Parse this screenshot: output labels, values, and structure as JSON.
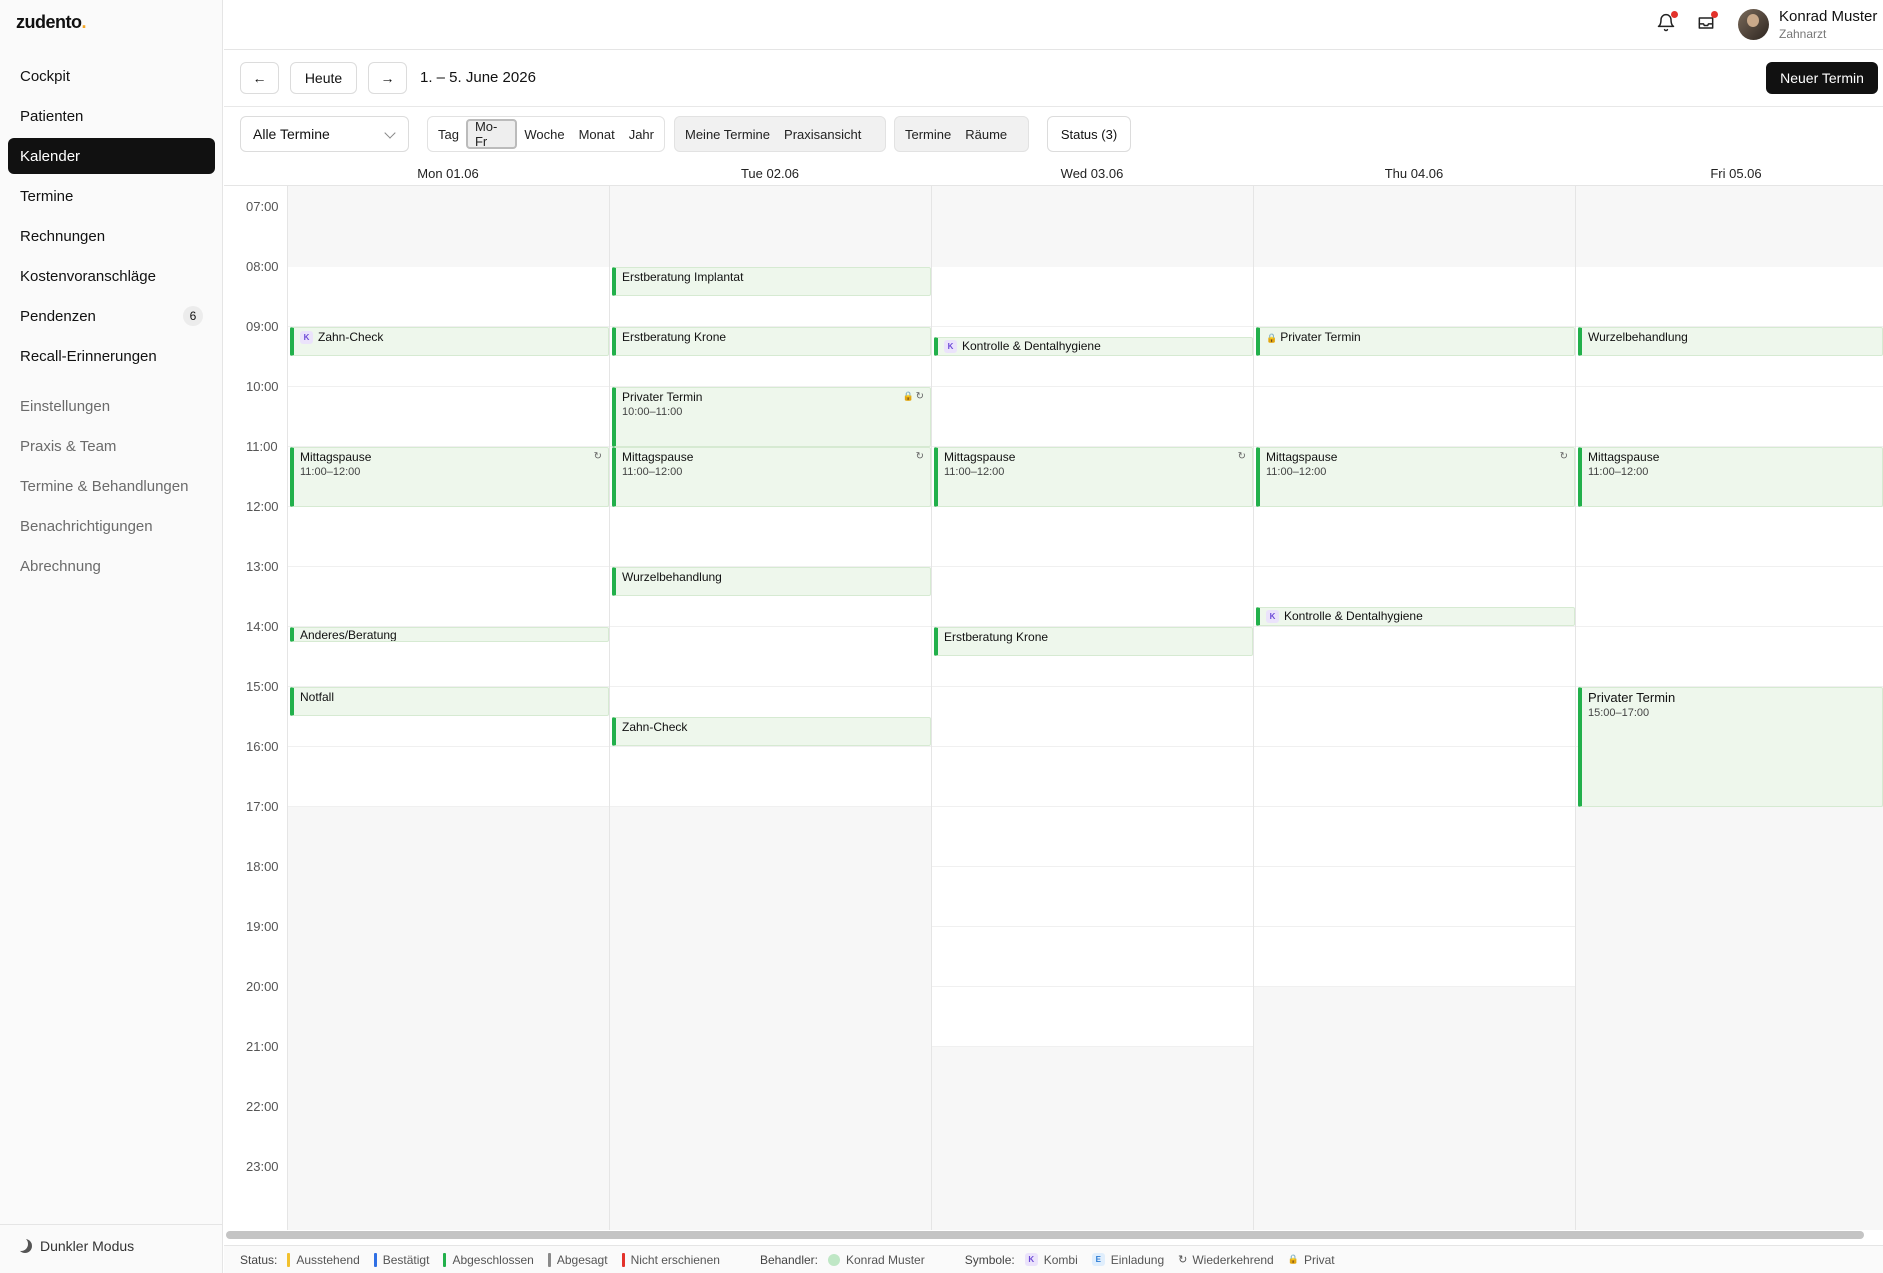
{
  "app": {
    "logo": "zudento",
    "logo_dot": "."
  },
  "sidebar": {
    "items": [
      {
        "label": "Cockpit"
      },
      {
        "label": "Patienten"
      },
      {
        "label": "Kalender",
        "active": true
      },
      {
        "label": "Termine"
      },
      {
        "label": "Rechnungen"
      },
      {
        "label": "Kostenvoranschläge"
      },
      {
        "label": "Pendenzen",
        "badge": "6"
      },
      {
        "label": "Recall-Erinnerungen"
      }
    ],
    "settings_heading": "Einstellungen",
    "settings_items": [
      {
        "label": "Praxis & Team"
      },
      {
        "label": "Termine & Behandlungen"
      },
      {
        "label": "Benachrichtigungen"
      },
      {
        "label": "Abrechnung"
      }
    ],
    "dark_mode": "Dunkler Modus"
  },
  "header": {
    "user_name": "Konrad Muster",
    "user_role": "Zahnarzt",
    "notifications": {
      "bell_unread": true,
      "mail_unread": true
    }
  },
  "toolbar": {
    "prev_label": "←",
    "today_label": "Heute",
    "next_label": "→",
    "date_range": "1. – 5. June 2026",
    "new_label": "Neuer Termin",
    "filter_select": "Alle Termine",
    "views": [
      "Tag",
      "Mo-Fr",
      "Woche",
      "Monat",
      "Jahr"
    ],
    "active_view": "Mo-Fr",
    "scopes": [
      "Meine Termine",
      "Praxisansicht"
    ],
    "modes": [
      "Termine",
      "Räume"
    ],
    "status_label": "Status (3)"
  },
  "calendar": {
    "days": [
      "Mon 01.06",
      "Tue 02.06",
      "Wed 03.06",
      "Thu 04.06",
      "Fri 05.06"
    ],
    "hours": [
      "07:00",
      "08:00",
      "09:00",
      "10:00",
      "11:00",
      "12:00",
      "13:00",
      "14:00",
      "15:00",
      "16:00",
      "17:00",
      "18:00",
      "19:00",
      "20:00",
      "21:00",
      "22:00",
      "23:00"
    ],
    "events": {
      "mon": [
        {
          "title": "Zahn-Check",
          "kombi": true
        },
        {
          "title": "Mittagspause",
          "time": "11:00–12:00",
          "recurring": true
        },
        {
          "title": "Anderes/Beratung"
        },
        {
          "title": "Notfall"
        }
      ],
      "tue": [
        {
          "title": "Erstberatung Implantat"
        },
        {
          "title": "Erstberatung Krone"
        },
        {
          "title": "Privater Termin",
          "time": "10:00–11:00",
          "private": true,
          "recurring": true
        },
        {
          "title": "Mittagspause",
          "time": "11:00–12:00",
          "recurring": true
        },
        {
          "title": "Wurzelbehandlung"
        },
        {
          "title": "Zahn-Check"
        }
      ],
      "wed": [
        {
          "title": "Kontrolle & Dentalhygiene",
          "kombi": true
        },
        {
          "title": "Mittagspause",
          "time": "11:00–12:00",
          "recurring": true
        },
        {
          "title": "Erstberatung Krone"
        }
      ],
      "thu": [
        {
          "title": "Privater Termin",
          "private": true
        },
        {
          "title": "Mittagspause",
          "time": "11:00–12:00",
          "recurring": true
        },
        {
          "title": "Kontrolle & Dentalhygiene",
          "kombi": true
        }
      ],
      "fri": [
        {
          "title": "Wurzelbehandlung"
        },
        {
          "title": "Mittagspause",
          "time": "11:00–12:00"
        },
        {
          "title": "Privater Termin",
          "time": "15:00–17:00"
        }
      ]
    }
  },
  "legend": {
    "status_label": "Status:",
    "statuses": [
      {
        "label": "Ausstehend",
        "color": "#f2c12e"
      },
      {
        "label": "Bestätigt",
        "color": "#2f6fe4"
      },
      {
        "label": "Abgeschlossen",
        "color": "#22b04b"
      },
      {
        "label": "Abgesagt",
        "color": "#8a8a8a"
      },
      {
        "label": "Nicht erschienen",
        "color": "#e3322b"
      }
    ],
    "provider_label": "Behandler:",
    "provider": "Konrad Muster",
    "symbols_label": "Symbole:",
    "symbols": [
      {
        "glyph": "K",
        "label": "Kombi"
      },
      {
        "glyph": "E",
        "label": "Einladung"
      },
      {
        "glyph": "↻",
        "label": "Wiederkehrend"
      },
      {
        "glyph": "🔒",
        "label": "Privat"
      }
    ]
  }
}
